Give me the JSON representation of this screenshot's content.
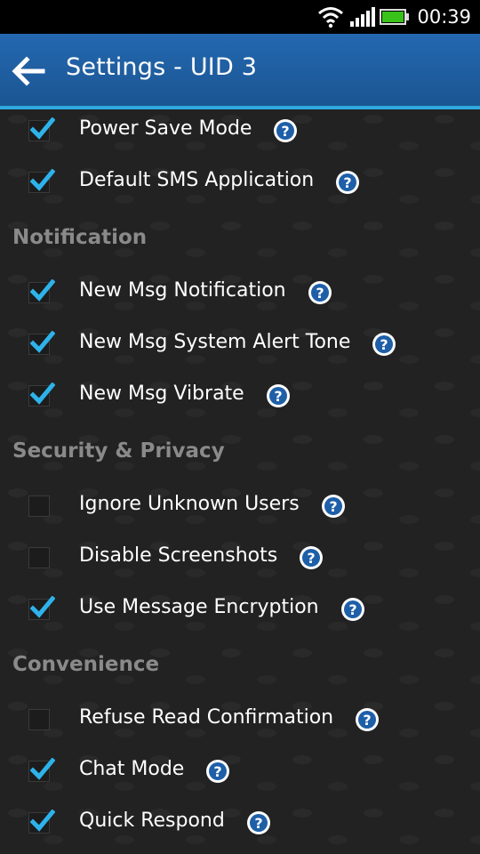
{
  "status_bar": {
    "time": "00:39",
    "icons": [
      "wifi-icon",
      "signal-icon",
      "battery-icon"
    ]
  },
  "app_bar": {
    "title": "Settings - UID 3",
    "back_icon": "back-arrow-icon"
  },
  "colors": {
    "accent": "#2ea8e0",
    "app_bar": "#1f5ea0",
    "check": "#2eb2ea",
    "section": "#8a8a8a"
  },
  "items_top": [
    {
      "label": "Power Save Mode",
      "checked": true
    },
    {
      "label": "Default SMS Application",
      "checked": true
    }
  ],
  "sections": [
    {
      "title": "Notification",
      "items": [
        {
          "label": "New Msg Notification",
          "checked": true
        },
        {
          "label": "New Msg System Alert Tone",
          "checked": true
        },
        {
          "label": "New Msg Vibrate",
          "checked": true
        }
      ]
    },
    {
      "title": "Security & Privacy",
      "items": [
        {
          "label": "Ignore Unknown Users",
          "checked": false
        },
        {
          "label": "Disable Screenshots",
          "checked": false
        },
        {
          "label": "Use Message Encryption",
          "checked": true
        }
      ]
    },
    {
      "title": "Convenience",
      "items": [
        {
          "label": "Refuse Read Confirmation",
          "checked": false
        },
        {
          "label": "Chat Mode",
          "checked": true
        },
        {
          "label": "Quick Respond",
          "checked": true
        }
      ]
    }
  ]
}
